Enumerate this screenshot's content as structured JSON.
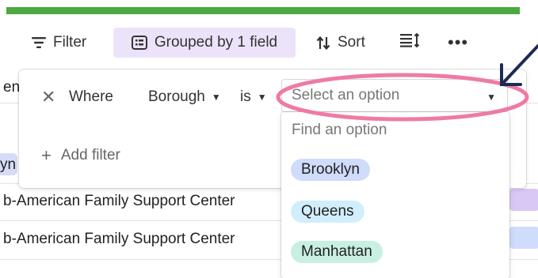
{
  "toolbar": {
    "filter_label": "Filter",
    "grouped_label": "Grouped by 1 field",
    "sort_label": "Sort",
    "more_label": "•••"
  },
  "table": {
    "partial_left_top": "en",
    "partial_left_chip": "yn",
    "rows": [
      "b-American Family Support Center",
      "b-American Family Support Center"
    ]
  },
  "filter": {
    "where_label": "Where",
    "field": "Borough",
    "operator": "is",
    "value_placeholder": "Select an option",
    "add_filter_label": "Add filter"
  },
  "dropdown": {
    "search_placeholder": "Find an option",
    "options": [
      {
        "label": "Brooklyn",
        "color": "#cfdcfb"
      },
      {
        "label": "Queens",
        "color": "#d1eefc"
      },
      {
        "label": "Manhattan",
        "color": "#c7f0e2"
      }
    ]
  },
  "colors": {
    "top_bar": "#4ca93f",
    "grouped_bg": "#ece3fb",
    "annotation_ellipse": "#ef7aa6",
    "annotation_arrow": "#1c2b55"
  }
}
